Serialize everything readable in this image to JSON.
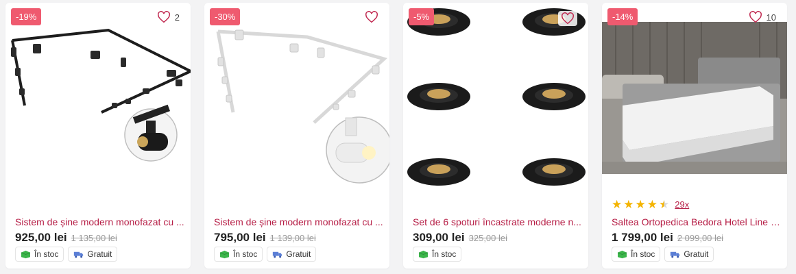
{
  "products": [
    {
      "badge": "-19%",
      "favorites": "2",
      "title": "Sistem de șine modern monofazat cu ...",
      "price": "925,00 lei",
      "old_price": "1 135,00 lei",
      "chips": [
        "În stoc",
        "Gratuit"
      ]
    },
    {
      "badge": "-30%",
      "favorites": "",
      "title": "Sistem de șine modern monofazat cu ...",
      "price": "795,00 lei",
      "old_price": "1 139,00 lei",
      "chips": [
        "În stoc",
        "Gratuit"
      ]
    },
    {
      "badge": "-5%",
      "favorites": "",
      "title": "Set de 6 spoturi încastrate moderne n...",
      "price": "309,00 lei",
      "old_price": "325,00 lei",
      "chips": [
        "În stoc"
      ]
    },
    {
      "badge": "-14%",
      "favorites": "10",
      "rating_value": 4.5,
      "rating_count": "29x",
      "title": "Saltea Ortopedica Bedora Hotel Line E...",
      "price": "1 799,00 lei",
      "old_price": "2 099,00 lei",
      "chips": [
        "În stoc",
        "Gratuit"
      ]
    }
  ],
  "colors": {
    "badge": "#ef5a6f",
    "title": "#b61d45",
    "star": "#f4b400"
  },
  "icons": {
    "favorite": "heart-outline-icon",
    "stock": "green-box-icon",
    "delivery": "truck-icon"
  }
}
